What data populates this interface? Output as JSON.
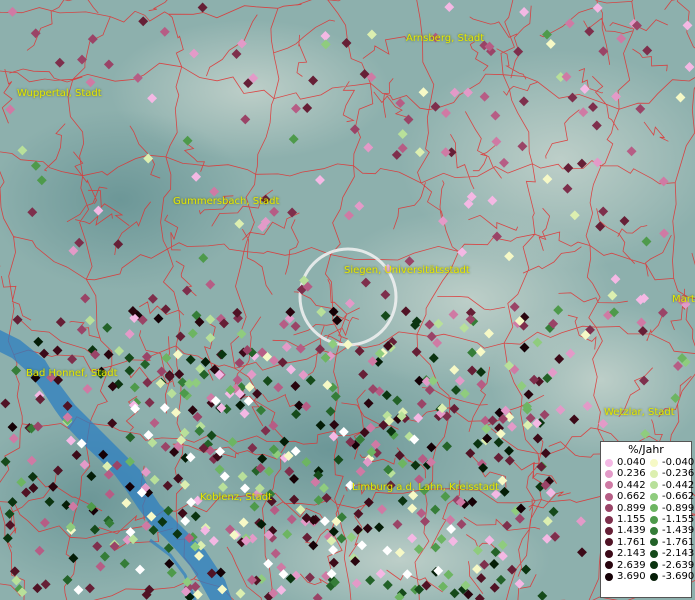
{
  "map": {
    "cities": [
      {
        "name": "Arnsberg, Stadt"
      },
      {
        "name": "Wuppertal, Stadt"
      },
      {
        "name": "Gummersbach, Stadt"
      },
      {
        "name": "Siegen, Universitätsstadt"
      },
      {
        "name": "Bad Honnef, Stadt"
      },
      {
        "name": "Wetzlar, Stadt"
      },
      {
        "name": "Koblenz, Stadt"
      },
      {
        "name": "Limburg a.d. Lahn, Kreisstadt"
      },
      {
        "name": "Mart"
      }
    ],
    "colors": {
      "river": "#2e7fc0",
      "borders": "#e03030",
      "label": "#e6e800"
    }
  },
  "legend": {
    "title": "%/Jahr",
    "positive": [
      {
        "label": "0.040",
        "color": "#f4b8e4"
      },
      {
        "label": "0.236",
        "color": "#e39ac8"
      },
      {
        "label": "0.442",
        "color": "#cf7aa4"
      },
      {
        "label": "0.662",
        "color": "#b65d85"
      },
      {
        "label": "0.899",
        "color": "#9a4467"
      },
      {
        "label": "1.155",
        "color": "#7e2f4c"
      },
      {
        "label": "1.439",
        "color": "#661f36"
      },
      {
        "label": "1.761",
        "color": "#501325"
      },
      {
        "label": "2.143",
        "color": "#3c0a18"
      },
      {
        "label": "2.639",
        "color": "#28050e"
      },
      {
        "label": "3.690",
        "color": "#150106"
      }
    ],
    "negative": [
      {
        "label": "-0.040",
        "color": "#f6f9c6"
      },
      {
        "label": "-0.236",
        "color": "#dcefb0"
      },
      {
        "label": "-0.442",
        "color": "#b8e09a"
      },
      {
        "label": "-0.662",
        "color": "#8fcc7e"
      },
      {
        "label": "-0.899",
        "color": "#6db562"
      },
      {
        "label": "-1.155",
        "color": "#4e9a4b"
      },
      {
        "label": "-1.439",
        "color": "#357d38"
      },
      {
        "label": "-1.761",
        "color": "#236228"
      },
      {
        "label": "-2.143",
        "color": "#154a1a"
      },
      {
        "label": "-2.639",
        "color": "#0b3410"
      },
      {
        "label": "-3.690",
        "color": "#041d07"
      }
    ]
  }
}
